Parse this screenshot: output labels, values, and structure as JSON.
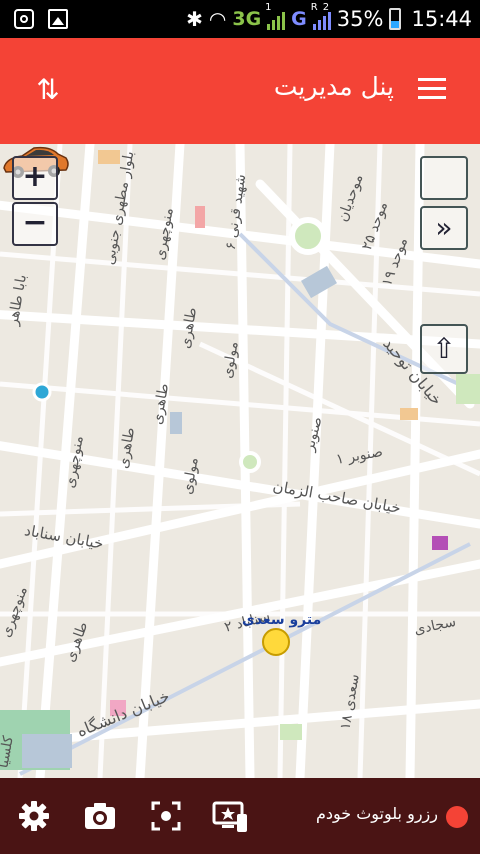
{
  "status_bar": {
    "network_1": "3G",
    "network_2": "G",
    "sim_1_index": "1",
    "sim_2_index": "2",
    "sim_r": "R",
    "battery": "35%",
    "time": "15:44"
  },
  "header": {
    "title": "پنل مدیریت",
    "color": "#f44336"
  },
  "map": {
    "labels": {
      "label_1": "بلوار مطهری جنوبی",
      "label_2": "منوچهری",
      "label_3": "شهید قرنی ۶",
      "label_4": "موحدیان",
      "label_5": "موحد ۲۵",
      "label_6": "موحد ۱۹",
      "label_7": "خیابان توحید",
      "label_8": "بابا طاهر",
      "label_9": "طاهری",
      "label_10": "مولوی",
      "label_11": "طاهری",
      "label_12": "منوچهری",
      "label_13": "طاهری",
      "label_14": "مولوی",
      "label_15": "صنوبر",
      "label_16": "صنوبر ۱",
      "label_17": "خیابان صاحب الزمان",
      "label_18": "خیابان سناباد",
      "label_19": "منوچهری",
      "label_20": "طاهری",
      "label_21": "سناباد ۲",
      "label_22": "سجادی",
      "label_23": "سعدی ۱۸",
      "label_24": "خیابان دانشگاه",
      "label_25": "کلسیا"
    },
    "metro_label": "مترو سعدی",
    "controls": {
      "zoom_in": "+",
      "zoom_out": "−",
      "expand": "»",
      "up": "⇧"
    }
  },
  "bottom_bar": {
    "bluetooth_reserve_label": "رزرو بلوتوث خودم",
    "icons": [
      "settings-icon",
      "camera-icon",
      "scan-icon",
      "screen-cast-icon"
    ]
  }
}
